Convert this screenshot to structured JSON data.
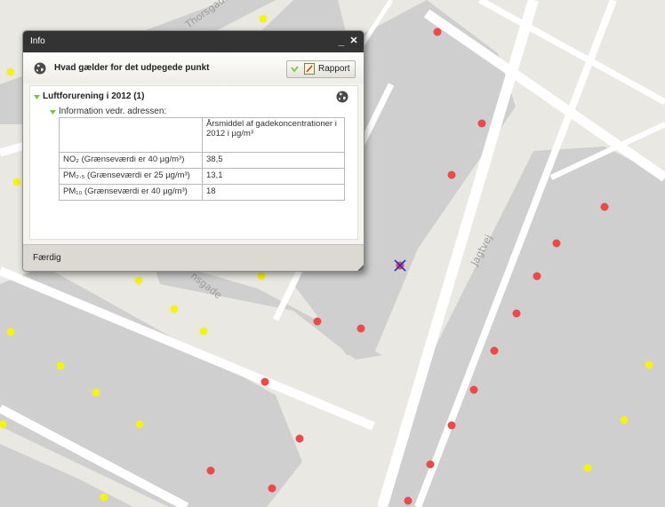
{
  "map": {
    "streets": [
      "Thorsgade",
      "Jagtvej",
      "nsgade"
    ],
    "colors": {
      "background": "#e9e8e3",
      "buildings": "#cfcfcf",
      "roads": "#ffffff",
      "red_points": "#ec4a4a",
      "yellow_points": "#f3f316"
    },
    "marker": "selected-point-marker"
  },
  "window": {
    "title": "Info",
    "minimize_symbol": "_",
    "close_symbol": "✕",
    "header_title": "Hvad gælder for det udpegede punkt",
    "report_label": "Rapport",
    "section_title": "Luftforurening i 2012 (1)",
    "subsection_title": "Information vedr. adressen:",
    "done_label": "Færdig"
  },
  "table": {
    "header": "Årsmiddel af gadekoncentrationer i 2012 i µg/m³",
    "rows": [
      {
        "label": "NO₂ (Grænseværdi er 40 µg/m³)",
        "value": "38,5"
      },
      {
        "label": "PM₂.₅ (Grænseværdi er 25 µg/m³)",
        "value": "13,1"
      },
      {
        "label": "PM₁₀ (Grænseværdi er 40 µg/m³)",
        "value": "18"
      }
    ]
  },
  "icons": [
    "globe-icon",
    "checkmark-icon",
    "report-icon",
    "expand-arrow-icon",
    "resize-grip-icon"
  ]
}
